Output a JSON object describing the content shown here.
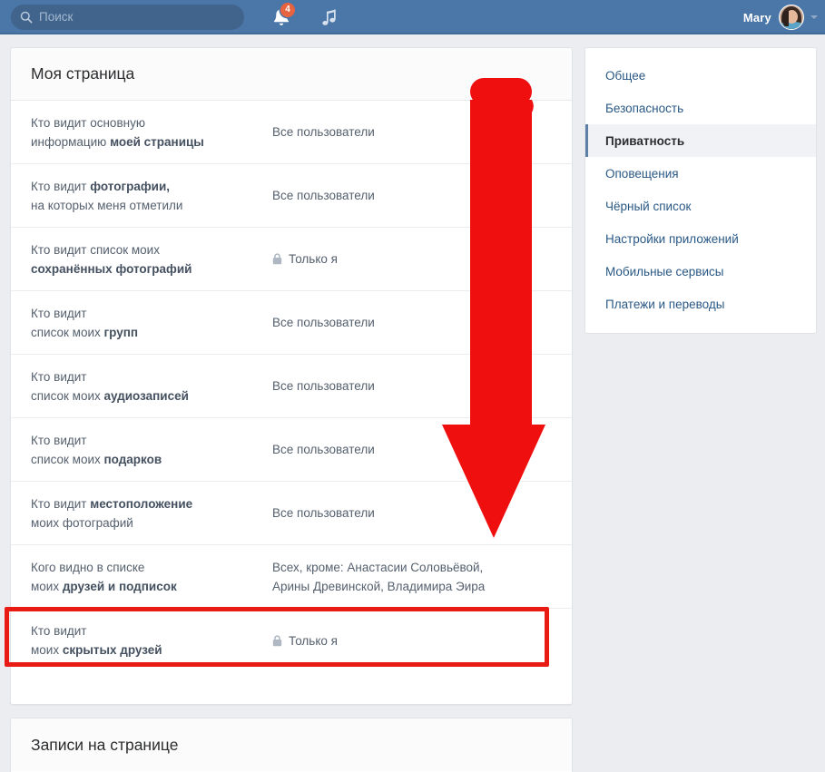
{
  "topbar": {
    "search": {
      "placeholder": "Поиск",
      "value": "",
      "icon": "search-icon"
    },
    "notifications": {
      "icon": "bell-icon",
      "badge_count": "4"
    },
    "music": {
      "icon": "music-note-icon"
    },
    "user": {
      "name": "Mary",
      "avatar": "user-avatar",
      "caret": "chevron-down-icon"
    },
    "background_color": "#4a76a8"
  },
  "main_card": {
    "title": "Моя страница",
    "rows": [
      {
        "label_line1": "Кто видит основную",
        "label_line2_plain": "информацию ",
        "label_line2_bold": "моей страницы",
        "value_line1": "Все пользователи",
        "value_line2": "",
        "locked": false
      },
      {
        "label_line1_plain": "Кто видит ",
        "label_line1_bold": "фотографии,",
        "label_line2": "на которых меня отметили",
        "value_line1": "Все пользователи",
        "value_line2": "",
        "locked": false
      },
      {
        "label_line1": "Кто видит список моих",
        "label_line2_bold": "сохранённых фотографий",
        "value_line1": "Только я",
        "value_line2": "",
        "locked": true
      },
      {
        "label_line1": "Кто видит",
        "label_line2_plain": "список моих ",
        "label_line2_bold": "групп",
        "value_line1": "Все пользователи",
        "value_line2": "",
        "locked": false
      },
      {
        "label_line1": "Кто видит",
        "label_line2_plain": "список моих ",
        "label_line2_bold": "аудиозаписей",
        "value_line1": "Все пользователи",
        "value_line2": "",
        "locked": false
      },
      {
        "label_line1": "Кто видит",
        "label_line2_plain": "список моих ",
        "label_line2_bold": "подарков",
        "value_line1": "Все пользователи",
        "value_line2": "",
        "locked": false
      },
      {
        "label_line1_plain": "Кто видит ",
        "label_line1_bold": "местоположение",
        "label_line2": "моих фотографий",
        "value_line1": "Все пользователи",
        "value_line2": "",
        "locked": false
      },
      {
        "label_line1": "Кого видно в списке",
        "label_line2_plain": "моих ",
        "label_line2_bold": "друзей и подписок",
        "value_line1": "Всех, кроме: Анастасии Соловьёвой,",
        "value_line2": "Арины Древинской, Владимира Эира",
        "locked": false,
        "highlighted": true
      },
      {
        "label_line1": "Кто видит",
        "label_line2_plain": "моих ",
        "label_line2_bold": "скрытых друзей",
        "value_line1": "Только я",
        "value_line2": "",
        "locked": true
      }
    ]
  },
  "posts_card": {
    "title": "Записи на странице"
  },
  "sidebar": {
    "items": [
      {
        "label": "Общее",
        "active": false
      },
      {
        "label": "Безопасность",
        "active": false
      },
      {
        "label": "Приватность",
        "active": true
      },
      {
        "label": "Оповещения",
        "active": false
      },
      {
        "label": "Чёрный список",
        "active": false
      },
      {
        "label": "Настройки приложений",
        "active": false
      },
      {
        "label": "Мобильные сервисы",
        "active": false
      },
      {
        "label": "Платежи и переводы",
        "active": false
      }
    ]
  },
  "annotations": {
    "arrow": {
      "name": "red-down-arrow",
      "color": "#ef0f0f",
      "direction": "down"
    },
    "highlight_box": {
      "name": "red-highlight-box",
      "color": "#e81b15",
      "target": "Кого видно в списке моих друзей и подписок"
    }
  },
  "colors": {
    "brand": "#4a76a8",
    "page_bg": "#ebedf0",
    "link": "#2a5885",
    "text": "#55606e",
    "accent_red": "#ef0f0f",
    "badge_orange": "#e8633f"
  }
}
